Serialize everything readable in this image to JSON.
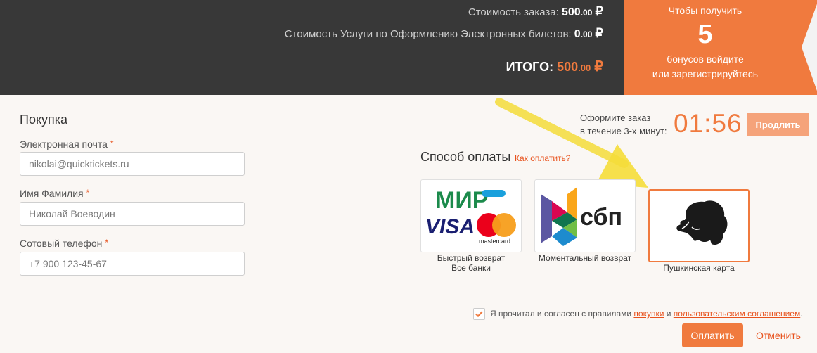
{
  "summary": {
    "order_label": "Стоимость заказа:",
    "order_amount": "500",
    "order_cents": ".00",
    "service_label": "Стоимость Услуги по Оформлению Электронных билетов:",
    "service_amount": "0",
    "service_cents": ".00",
    "total_label": "ИТОГО:",
    "total_amount": "500",
    "total_cents": ".00",
    "currency": "₽"
  },
  "bonus": {
    "line1": "Чтобы получить",
    "number": "5",
    "line2": "бонусов войдите",
    "line3": "или зарегистрируйтесь"
  },
  "form": {
    "title": "Покупка",
    "required_mark": "*",
    "email_label": "Электронная почта",
    "email_placeholder": "nikolai@quicktickets.ru",
    "name_label": "Имя Фамилия",
    "name_placeholder": "Николай Воеводин",
    "phone_label": "Сотовый телефон",
    "phone_placeholder": "+7 900 123-45-67"
  },
  "timer": {
    "text1": "Оформите заказ",
    "text2": "в течение 3-х минут:",
    "value": "01:56",
    "extend_label": "Продлить"
  },
  "payment": {
    "title": "Способ оплаты",
    "help_link": "Как оплатить?",
    "methods": [
      {
        "line1": "Быстрый возврат",
        "line2": "Все банки",
        "logo_text_mir": "МИР",
        "logo_text_visa": "VISA",
        "logo_text_mc": "mastercard"
      },
      {
        "line1": "Моментальный возврат",
        "logo_text": "сбп"
      },
      {
        "line1": "Пушкинская карта"
      }
    ]
  },
  "agreement": {
    "text_before": "Я прочитал и согласен с правилами ",
    "link1": "покупки",
    "text_mid": " и ",
    "link2": "пользовательским соглашением",
    "text_after": ".",
    "checked": true
  },
  "actions": {
    "pay_label": "Оплатить",
    "cancel_label": "Отменить"
  },
  "colors": {
    "accent": "#f07a3e",
    "dark": "#383838",
    "arrow": "#f5dd3a"
  }
}
